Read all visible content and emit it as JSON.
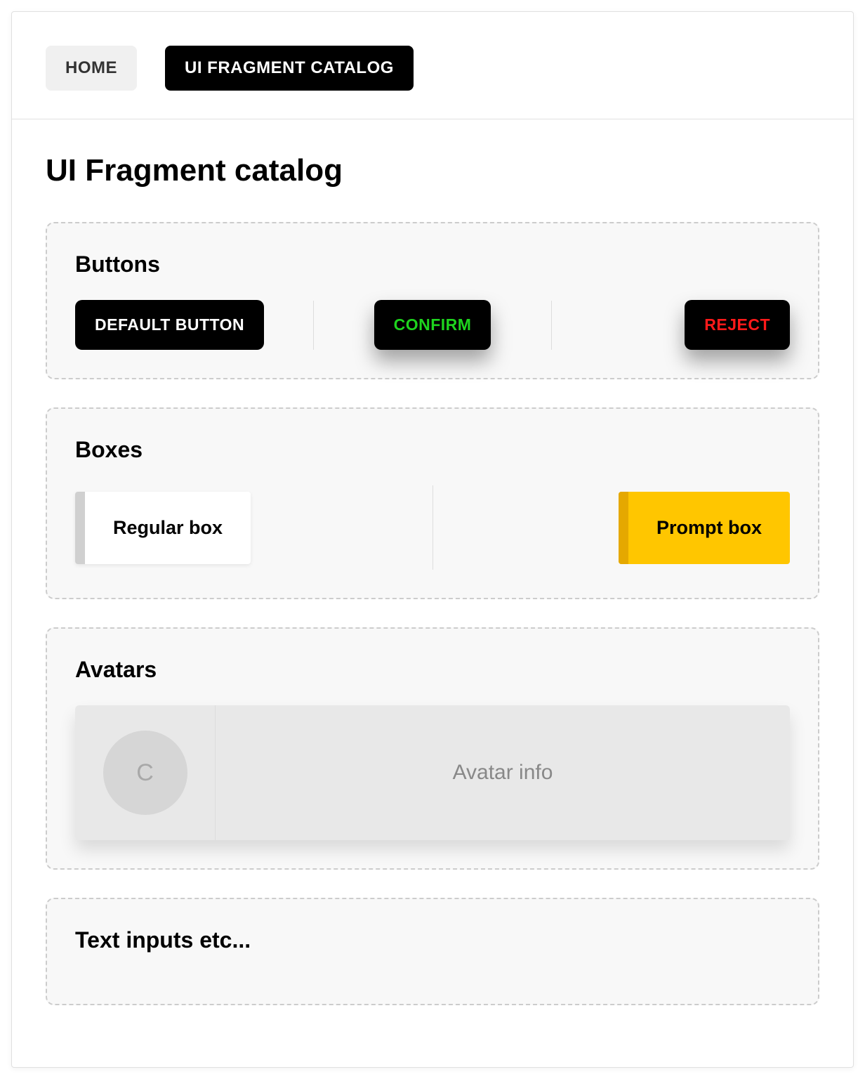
{
  "nav": {
    "home": "HOME",
    "catalog": "UI FRAGMENT CATALOG"
  },
  "page": {
    "title": "UI Fragment catalog"
  },
  "sections": {
    "buttons": {
      "title": "Buttons",
      "default_label": "DEFAULT BUTTON",
      "confirm_label": "CONFIRM",
      "reject_label": "REJECT"
    },
    "boxes": {
      "title": "Boxes",
      "regular_label": "Regular box",
      "prompt_label": "Prompt box"
    },
    "avatars": {
      "title": "Avatars",
      "initial": "C",
      "info": "Avatar info"
    },
    "text_inputs": {
      "title": "Text inputs etc..."
    }
  }
}
